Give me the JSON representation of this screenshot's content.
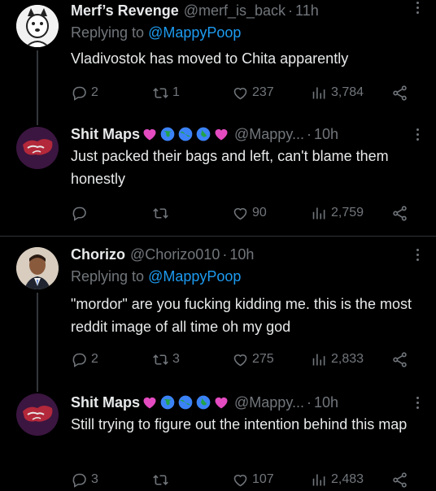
{
  "tweets": [
    {
      "name": "Merf’s Revenge",
      "handle": "@merf_is_back",
      "time": "11h",
      "replying_label": "Replying to ",
      "replying_handle": "@MappyPoop",
      "text": "Vladivostok has moved to Chita apparently",
      "reply_count": "2",
      "retweet_count": "1",
      "like_count": "237",
      "view_count": "3,784"
    },
    {
      "name": "Shit Maps",
      "handle": "@Mappy...",
      "time": "10h",
      "text": "Just packed their bags and left, can't blame them honestly",
      "reply_count": "",
      "retweet_count": "",
      "like_count": "90",
      "view_count": "2,759"
    },
    {
      "name": "Chorizo",
      "handle": "@Chorizo010",
      "time": "10h",
      "replying_label": "Replying to ",
      "replying_handle": "@MappyPoop",
      "text": "\"mordor\" are you fucking kidding me. this is the most reddit image of all time oh my god",
      "reply_count": "2",
      "retweet_count": "3",
      "like_count": "275",
      "view_count": "2,833"
    },
    {
      "name": "Shit Maps",
      "handle": "@Mappy...",
      "time": "10h",
      "text": "Still trying to figure out the intention behind this map",
      "reply_count": "3",
      "retweet_count": "",
      "like_count": "107",
      "view_count": "2,483"
    }
  ],
  "separator": "·",
  "colors": {
    "background": "#000000",
    "text": "#e7e9ea",
    "muted": "#71767b",
    "link": "#1d9bf0",
    "divider": "#2f3336"
  },
  "icons": [
    "reply-icon",
    "retweet-icon",
    "like-icon",
    "views-icon",
    "share-icon",
    "more-icon",
    "heart-emoji",
    "globe-emoji"
  ]
}
